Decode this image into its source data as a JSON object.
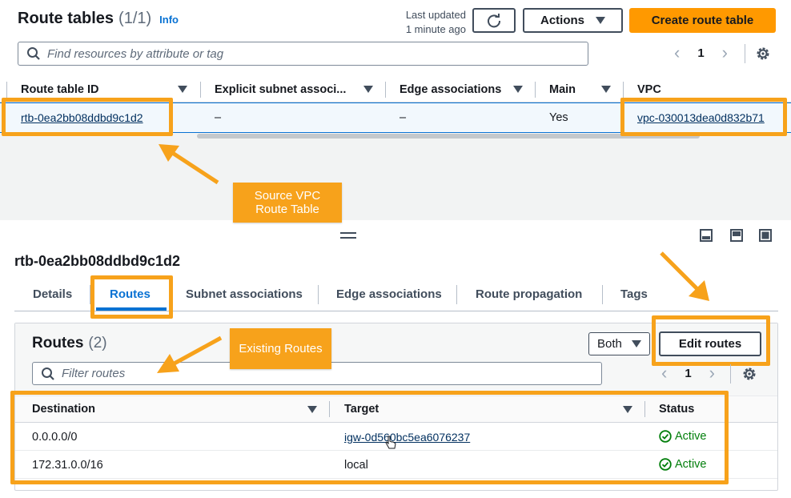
{
  "top": {
    "title": "Route tables",
    "count": "(1/1)",
    "info": "Info",
    "last_updated_label": "Last updated",
    "last_updated_value": "1 minute ago",
    "actions_label": "Actions",
    "create_label": "Create route table",
    "search_placeholder": "Find resources by attribute or tag",
    "page": "1"
  },
  "table": {
    "columns": [
      "Route table ID",
      "Explicit subnet associ...",
      "Edge associations",
      "Main",
      "VPC"
    ],
    "row": {
      "id": "rtb-0ea2bb08ddbd9c1d2",
      "explicit": "–",
      "edge": "–",
      "main": "Yes",
      "vpc": "vpc-030013dea0d832b71"
    }
  },
  "callouts": {
    "source": "Source VPC Route Table",
    "existing": "Existing Routes"
  },
  "detail": {
    "title": "rtb-0ea2bb08ddbd9c1d2",
    "tabs": [
      "Details",
      "Routes",
      "Subnet associations",
      "Edge associations",
      "Route propagation",
      "Tags"
    ],
    "active_tab": "Routes"
  },
  "routes": {
    "title": "Routes",
    "count": "(2)",
    "filter_value": "Both",
    "edit_label": "Edit routes",
    "filter_placeholder": "Filter routes",
    "page": "1",
    "columns": [
      "Destination",
      "Target",
      "Status"
    ],
    "rows": [
      {
        "destination": "0.0.0.0/0",
        "target": "igw-0d560bc5ea6076237",
        "status": "Active"
      },
      {
        "destination": "172.31.0.0/16",
        "target": "local",
        "status": "Active"
      }
    ]
  },
  "colors": {
    "accent": "#ff9900",
    "annotation": "#f7a21b",
    "link": "#033160",
    "active": "#037f0c"
  }
}
